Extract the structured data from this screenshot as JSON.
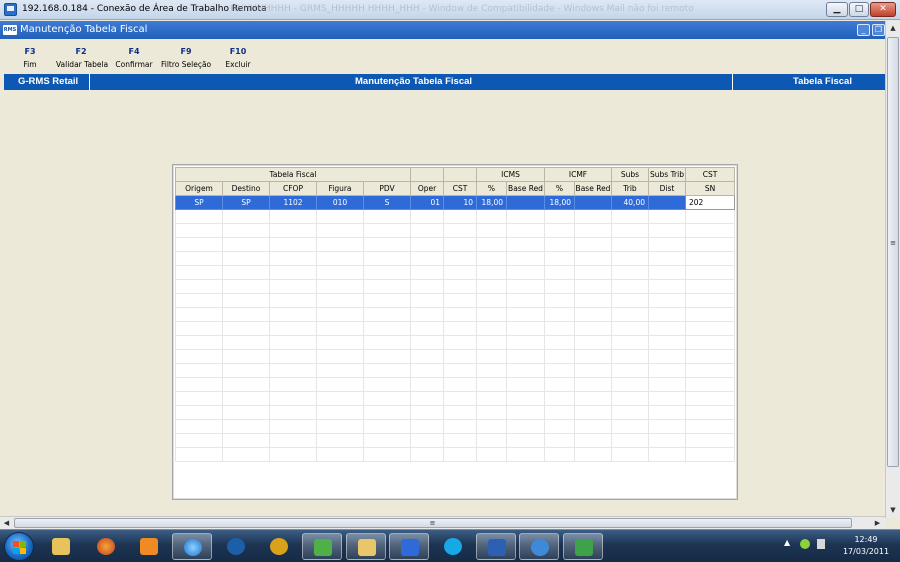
{
  "remote_window": {
    "title": "192.168.0.184 - Conexão de Área de Trabalho Remota",
    "background_caption": "HHHHHHHHH - GRMS_HHHHH HHHH_HHH - Window de Compatibilidade - Windows Mail não foi remoto",
    "buttons": {
      "minimize": "▁",
      "maximize": "□",
      "close": "✕"
    }
  },
  "app": {
    "title": "Manutenção Tabela Fiscal",
    "logo_text": "RMS",
    "inner_buttons": {
      "minimize": "_",
      "restore": "❐"
    }
  },
  "function_keys": [
    {
      "key": "F3",
      "label": "Fim"
    },
    {
      "key": "F2",
      "label": "Validar Tabela"
    },
    {
      "key": "F4",
      "label": "Confirmar"
    },
    {
      "key": "F9",
      "label": "Filtro Seleção"
    },
    {
      "key": "F10",
      "label": "Excluir"
    }
  ],
  "header_bar": {
    "left": "G-RMS Retail",
    "center": "Manutenção Tabela Fiscal",
    "right": "Tabela Fiscal"
  },
  "grid": {
    "group_headers": [
      "Tabela Fiscal",
      "",
      "",
      "ICMS",
      "ICMF",
      "Subs",
      "Subs Trib",
      "CST"
    ],
    "columns": [
      "Origem",
      "Destino",
      "CFOP",
      "Figura",
      "PDV",
      "Oper",
      "CST",
      "%",
      "Base Red",
      "%",
      "Base Red",
      "Trib",
      "Dist",
      "SN"
    ],
    "rows": [
      [
        "SP",
        "SP",
        "1102",
        "010",
        "S",
        "01",
        "10",
        "18,00",
        "",
        "18,00",
        "",
        "40,00",
        "",
        "202"
      ]
    ],
    "empty_row_count": 18,
    "selection_color": "#2f6ad9"
  },
  "scrollbars": {
    "up": "▲",
    "down": "▼",
    "left": "◀",
    "right": "▶",
    "grip": "≡"
  },
  "taskbar": {
    "apps": [
      "explorer-icon",
      "firefox-icon",
      "media-player-icon",
      "ie-icon",
      "hp-icon",
      "ultraedit-icon",
      "messenger-icon",
      "outlook-icon",
      "remote-desktop-icon",
      "skype-icon",
      "word-icon",
      "psi-icon",
      "app-icon"
    ],
    "tray_arrow": "▲",
    "time": "12:49",
    "date": "17/03/2011"
  }
}
